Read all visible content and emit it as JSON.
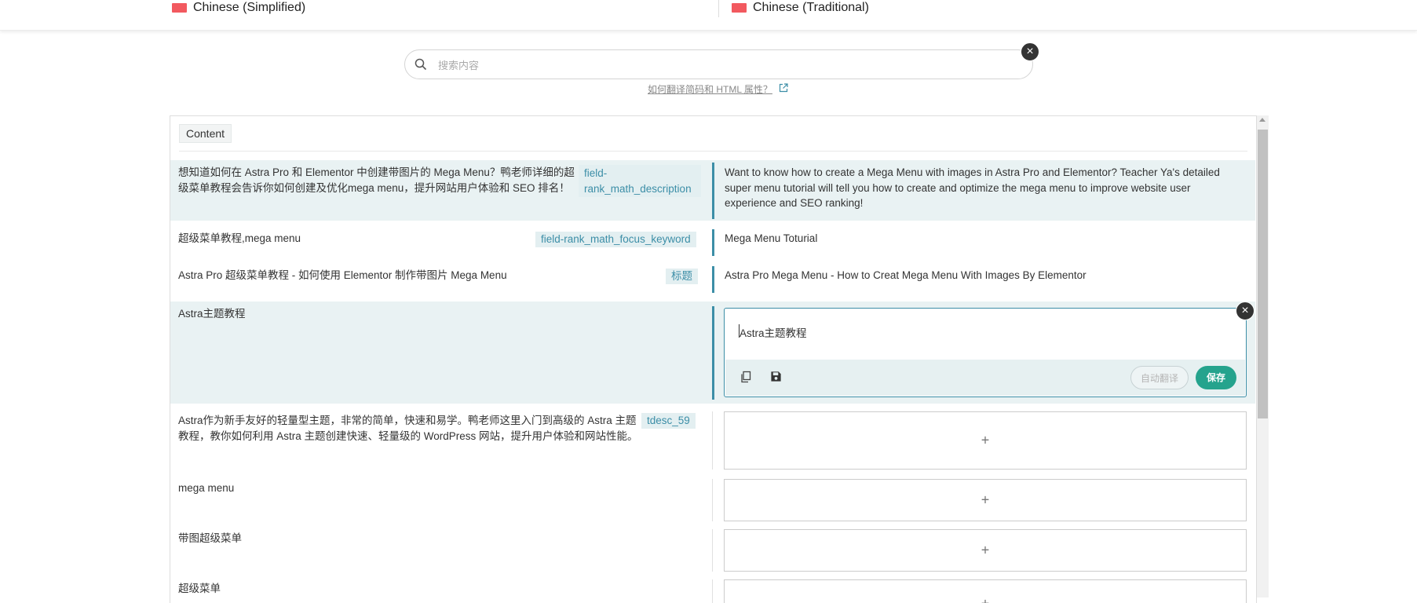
{
  "languages": {
    "source": "Chinese (Simplified)",
    "target": "Chinese (Traditional)"
  },
  "search": {
    "placeholder": "搜索内容"
  },
  "help_link": "如何翻译简码和 HTML 属性？",
  "section_tag": "Content",
  "rows": [
    {
      "source": "想知道如何在 Astra Pro 和 Elementor 中创建带图片的 Mega Menu？鸭老师详细的超级菜单教程会告诉你如何创建及优化mega menu，提升网站用户体验和 SEO 排名！",
      "key": "field-rank_math_description",
      "target": "Want to know how to create a Mega Menu with images in Astra Pro and Elementor? Teacher Ya's detailed super menu tutorial will tell you how to create and optimize the mega menu to improve website user experience and SEO ranking!"
    },
    {
      "source": "超级菜单教程,mega menu",
      "key": "field-rank_math_focus_keyword",
      "target": "Mega Menu Toturial"
    },
    {
      "source": "Astra Pro 超级菜单教程 - 如何使用 Elementor 制作带图片 Mega Menu",
      "key": "标题",
      "target": "Astra Pro Mega Menu - How to Creat Mega Menu With Images By Elementor"
    },
    {
      "source": "Astra主题教程",
      "key": "",
      "editor_value": "Astra主题教程",
      "auto_translate": "自动翻译",
      "save": "保存"
    },
    {
      "source": "Astra作为新手友好的轻量型主题，非常的简单，快速和易学。鸭老师这里入门到高级的 Astra 主题教程，教你如何利用 Astra 主题创建快速、轻量级的 WordPress 网站，提升用户体验和网站性能。",
      "key": "tdesc_59",
      "add": "+"
    },
    {
      "source": "mega menu",
      "key": "",
      "add": "+"
    },
    {
      "source": "带图超级菜单",
      "key": "",
      "add": "+"
    },
    {
      "source": "超级菜单",
      "key": "",
      "add": "+"
    }
  ],
  "colors": {
    "accent": "#3c8ea7",
    "save": "#25a38d",
    "highlight_row": "#e9f2f3",
    "flag": "#f2595f"
  }
}
